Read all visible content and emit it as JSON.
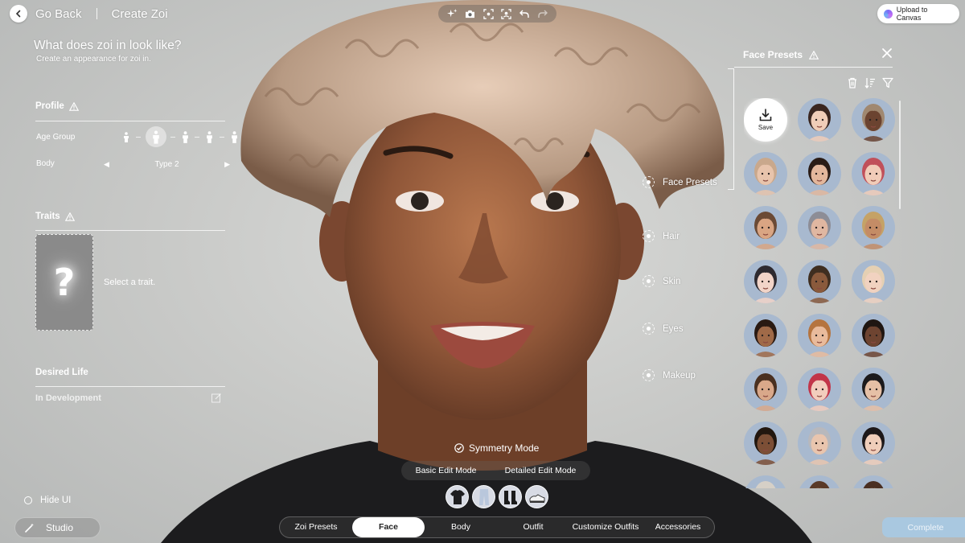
{
  "header": {
    "back_label": "Go Back",
    "breadcrumb": "Create Zoi",
    "toolbar_icons": [
      "sparkle-icon",
      "camera-icon",
      "focus-icon",
      "face-scan-icon",
      "undo-icon",
      "redo-icon"
    ],
    "upload_label": "Upload to Canvas"
  },
  "left_panel": {
    "title": "What does zoi in look like?",
    "subtitle": "Create an appearance for zoi in.",
    "profile": {
      "heading": "Profile",
      "age_label": "Age Group",
      "age_selected_index": 1,
      "body_label": "Body",
      "body_value": "Type 2"
    },
    "traits": {
      "heading": "Traits",
      "placeholder_glyph": "?",
      "prompt": "Select a trait."
    },
    "desired_life": {
      "heading": "Desired Life",
      "status": "In Development"
    },
    "hide_ui_label": "Hide UI",
    "studio_label": "Studio"
  },
  "categories": [
    "Face Presets",
    "Hair",
    "Skin",
    "Eyes",
    "Makeup"
  ],
  "preset_panel": {
    "title": "Face Presets",
    "save_label": "Save",
    "tool_icons": [
      "trash-icon",
      "sort-icon",
      "filter-icon"
    ],
    "presets": [
      {
        "skin": "#f0cdb8",
        "hair": "#3a2620",
        "bg": "#a8b9cf"
      },
      {
        "skin": "#6b4330",
        "hair": "#a08870",
        "bg": "#a8b9cf"
      },
      {
        "skin": "#e8c4ac",
        "hair": "#c9a88c",
        "bg": "#a8b9cf"
      },
      {
        "skin": "#e3b79c",
        "hair": "#2a1c16",
        "bg": "#a8b9cf"
      },
      {
        "skin": "#f1ccb8",
        "hair": "#c0505a",
        "bg": "#a8b9cf"
      },
      {
        "skin": "#d9a583",
        "hair": "#6b4a35",
        "bg": "#a8b9cf"
      },
      {
        "skin": "#e0b7a1",
        "hair": "#8d8d96",
        "bg": "#a8b9cf"
      },
      {
        "skin": "#c48c66",
        "hair": "#c5a266",
        "bg": "#a8b9cf"
      },
      {
        "skin": "#f2d4c8",
        "hair": "#2e2a30",
        "bg": "#a8b9cf"
      },
      {
        "skin": "#8a5a3c",
        "hair": "#3f2e20",
        "bg": "#a8b9cf"
      },
      {
        "skin": "#f1d2c0",
        "hair": "#e5d0b3",
        "bg": "#a8b9cf"
      },
      {
        "skin": "#a06a48",
        "hair": "#2a1a12",
        "bg": "#a8b9cf"
      },
      {
        "skin": "#e9bb9c",
        "hair": "#b5743f",
        "bg": "#a8b9cf"
      },
      {
        "skin": "#6e4431",
        "hair": "#1f1612",
        "bg": "#a8b9cf"
      },
      {
        "skin": "#d9a88a",
        "hair": "#4a3020",
        "bg": "#a8b9cf"
      },
      {
        "skin": "#f2cdbd",
        "hair": "#c2364a",
        "bg": "#a8b9cf"
      },
      {
        "skin": "#e6c0a6",
        "hair": "#1c1a1c",
        "bg": "#a8b9cf"
      },
      {
        "skin": "#7c4f36",
        "hair": "#22170f",
        "bg": "#a8b9cf"
      },
      {
        "skin": "#e9c5ae",
        "hair": "#b8b8bc",
        "bg": "#a8b9cf"
      },
      {
        "skin": "#f0ceba",
        "hair": "#1d1819",
        "bg": "#a8b9cf"
      },
      {
        "skin": "#e8c6b3",
        "hair": "#d6d0c7",
        "bg": "#a8b9cf"
      },
      {
        "skin": "#d5a888",
        "hair": "#5a3a28",
        "bg": "#a8b9cf"
      },
      {
        "skin": "#c9967a",
        "hair": "#4a2f22",
        "bg": "#a8b9cf"
      }
    ]
  },
  "symmetry_label": "Symmetry Mode",
  "edit_modes": [
    "Basic Edit Mode",
    "Detailed Edit Mode"
  ],
  "outfit_icons": [
    "shirt-icon",
    "pants-icon",
    "boots-icon",
    "sneakers-icon"
  ],
  "bottom_tabs": {
    "items": [
      "Zoi Presets",
      "Face",
      "Body",
      "Outfit",
      "Customize Outfits",
      "Accessories"
    ],
    "active": "Face"
  },
  "complete_label": "Complete",
  "colors": {
    "accent": "#ffffff",
    "complete_disabled": "#a9c8e0",
    "panel_avatar_bg": "#a8b9cf"
  }
}
